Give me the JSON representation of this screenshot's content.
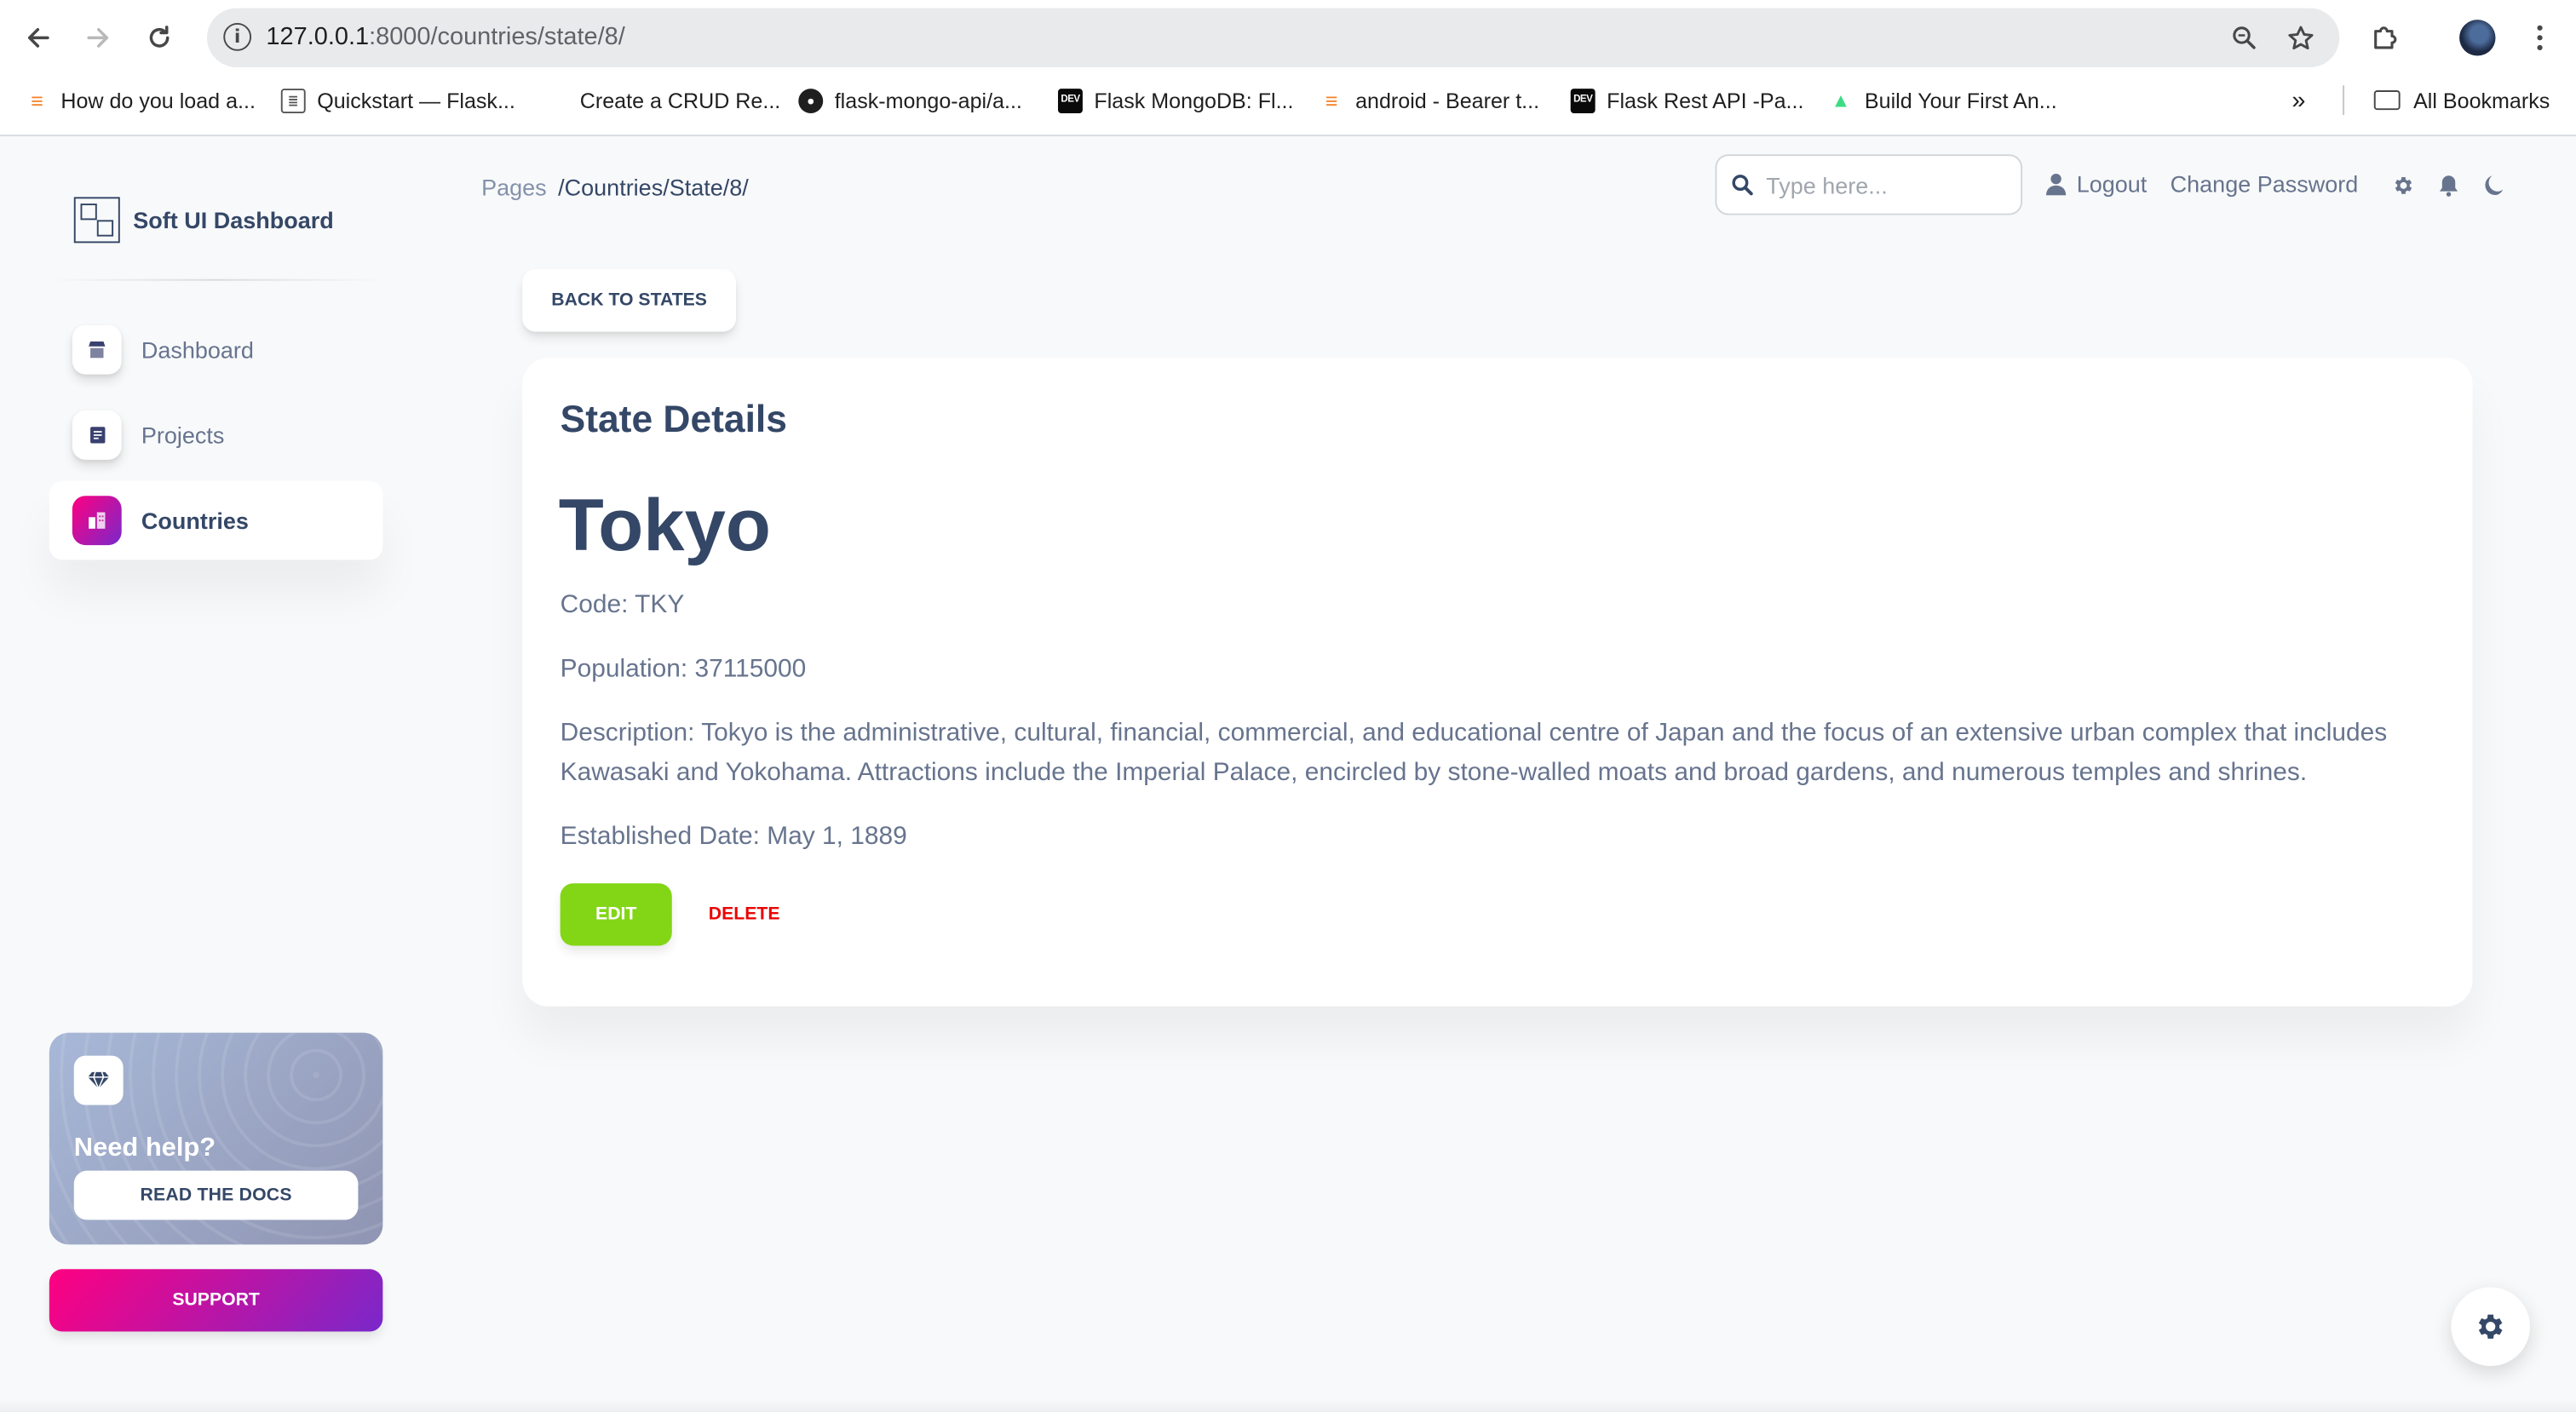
{
  "browser": {
    "url_host": "127.0.0.1",
    "url_path": ":8000/countries/state/8/",
    "bookmarks": [
      {
        "label": "How do you load a...",
        "icon": "stackoverflow-icon"
      },
      {
        "label": "Quickstart — Flask...",
        "icon": "document-icon"
      },
      {
        "label": "Create a CRUD Re...",
        "icon": "none"
      },
      {
        "label": "flask-mongo-api/a...",
        "icon": "github-icon"
      },
      {
        "label": "Flask MongoDB: Fl...",
        "icon": "dev-icon"
      },
      {
        "label": "android - Bearer t...",
        "icon": "stackoverflow-icon"
      },
      {
        "label": "Flask Rest API -Pa...",
        "icon": "dev-icon"
      },
      {
        "label": "Build Your First An...",
        "icon": "android-icon"
      }
    ],
    "more_bookmarks": "»",
    "all_bookmarks": "All Bookmarks"
  },
  "sidebar": {
    "brand": "Soft UI Dashboard",
    "items": [
      {
        "label": "Dashboard",
        "icon": "shop-icon",
        "active": false
      },
      {
        "label": "Projects",
        "icon": "document-icon",
        "active": false
      },
      {
        "label": "Countries",
        "icon": "office-icon",
        "active": true
      }
    ],
    "help": {
      "title": "Need help?",
      "button": "READ THE DOCS"
    },
    "support_button": "SUPPORT"
  },
  "navbar": {
    "breadcrumb_pages": "Pages",
    "breadcrumb_current": "/Countries/State/8/",
    "search_placeholder": "Type here...",
    "logout": "Logout",
    "change_password": "Change Password"
  },
  "main": {
    "back_button": "BACK TO STATES",
    "card_title": "State Details",
    "state_name": "Tokyo",
    "code": "Code: TKY",
    "population": "Population: 37115000",
    "description": "Description: Tokyo is the administrative, cultural, financial, commercial, and educational centre of Japan and the focus of an extensive urban complex that includes Kawasaki and Yokohama. Attractions include the Imperial Palace, encircled by stone-walled moats and broad gardens, and numerous temples and shrines.",
    "established": "Established Date: May 1, 1889",
    "edit_button": "EDIT",
    "delete_button": "DELETE"
  },
  "colors": {
    "primary_gradient_start": "#7928ca",
    "primary_gradient_end": "#ff0080",
    "success": "#82d616",
    "danger": "#ea0606",
    "text_dark": "#344767",
    "text_muted": "#67748e"
  }
}
